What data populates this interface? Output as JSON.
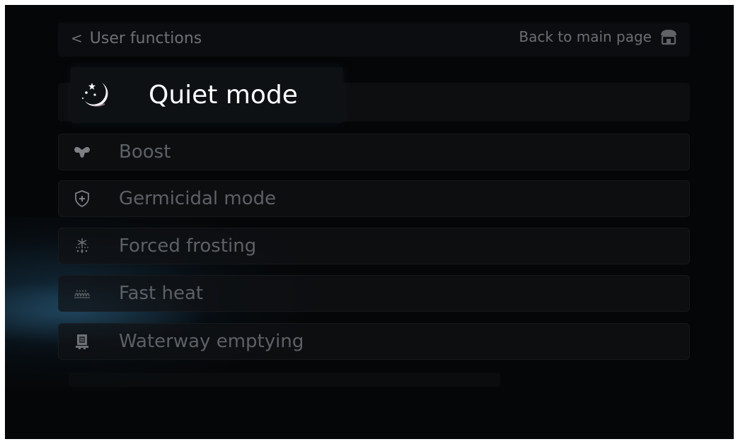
{
  "header": {
    "back_label": "User functions",
    "home_label": "Back to main page"
  },
  "current_mode": {
    "label": "Quiet mode",
    "icon": "moon-stars-icon"
  },
  "menu": {
    "items": [
      {
        "label": "Boost",
        "icon": "muscle-icon"
      },
      {
        "label": "Germicidal mode",
        "icon": "shield-plus-icon"
      },
      {
        "label": "Forced frosting",
        "icon": "snowflake-drip-icon"
      },
      {
        "label": "Fast heat",
        "icon": "heating-coil-icon"
      },
      {
        "label": "Waterway emptying",
        "icon": "water-tank-icon"
      }
    ]
  },
  "colors": {
    "background": "#050607",
    "row_bg": "#101215",
    "text_dim": "#5c6166",
    "text_active": "#ffffff",
    "glow": "#28648c"
  }
}
